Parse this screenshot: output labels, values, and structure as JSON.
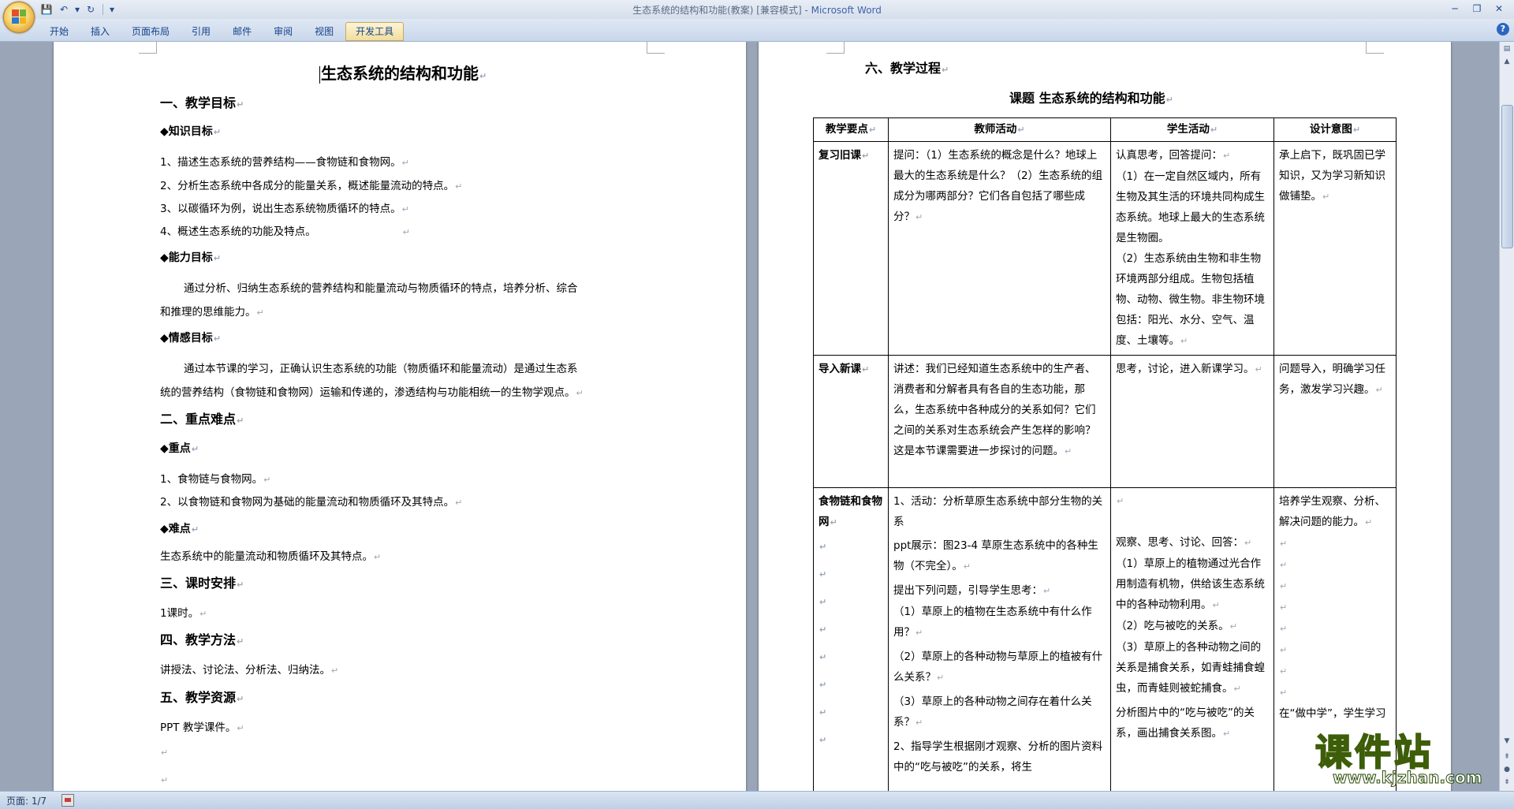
{
  "window": {
    "title_doc": "生态系统的结构和功能(教案) [兼容模式] - ",
    "title_app": "Microsoft Word",
    "controls": [
      "─",
      "❐",
      "✕"
    ]
  },
  "qat": {
    "save": "💾",
    "undo": "↶",
    "undo_dd": "▾",
    "redo": "↻",
    "customize": "▾"
  },
  "ribbon": {
    "tabs": [
      "开始",
      "插入",
      "页面布局",
      "引用",
      "邮件",
      "审阅",
      "视图",
      "开发工具"
    ],
    "active_tab": "开发工具",
    "help": "?"
  },
  "page1": {
    "title": "生态系统的结构和功能",
    "s1": "一、教学目标",
    "knowledge": "◆知识目标",
    "k1": "1、描述生态系统的营养结构——食物链和食物网。",
    "k2": "2、分析生态系统中各成分的能量关系，概述能量流动的特点。",
    "k3": "3、以碳循环为例，说出生态系统物质循环的特点。",
    "k4": "4、概述生态系统的功能及特点。",
    "ability": "◆能力目标",
    "ab1": "通过分析、归纳生态系统的营养结构和能量流动与物质循环的特点，培养分析、综合",
    "ab2": "和推理的思维能力。",
    "emotion": "◆情感目标",
    "em1": "通过本节课的学习，正确认识生态系统的功能（物质循环和能量流动）是通过生态系",
    "em2": "统的营养结构（食物链和食物网）运输和传递的，渗透结构与功能相统一的生物学观点。",
    "s2": "二、重点难点",
    "key": "◆重点",
    "key1": "1、食物链与食物网。",
    "key2": "2、以食物链和食物网为基础的能量流动和物质循环及其特点。",
    "diff": "◆难点",
    "diff1": "生态系统中的能量流动和物质循环及其特点。",
    "s3": "三、课时安排",
    "hours": "1课时。",
    "s4": "四、教学方法",
    "methods": "讲授法、讨论法、分析法、归纳法。",
    "s5": "五、教学资源",
    "res": "PPT 教学课件。"
  },
  "page2": {
    "s6": "六、教学过程",
    "subject": "课题    生态系统的结构和功能",
    "headers": [
      "教学要点",
      "教师活动",
      "学生活动",
      "设计意图"
    ],
    "r1": {
      "point": "复习旧课",
      "teacher": "提问：（1）生态系统的概念是什么？地球上最大的生态系统是什么？（2）生态系统的组成分为哪两部分？它们各自包括了哪些成分？",
      "student_1": "认真思考，回答提问：",
      "student_2": "（1）在一定自然区域内，所有生物及其生活的环境共同构成生态系统。地球上最大的生态系统是生物圈。",
      "student_3": "（2）生态系统由生物和非生物环境两部分组成。生物包括植物、动物、微生物。非生物环境包括：阳光、水分、空气、温度、土壤等。",
      "design": "承上启下，既巩固已学知识，又为学习新知识做铺垫。"
    },
    "r2": {
      "point": "导入新课",
      "teacher": "讲述：我们已经知道生态系统中的生产者、消费者和分解者具有各自的生态功能，那么，生态系统中各种成分的关系如何？它们之间的关系对生态系统会产生怎样的影响？这是本节课需要进一步探讨的问题。",
      "student": "思考，讨论，进入新课学习。",
      "design": "问题导入，明确学习任务，激发学习兴趣。"
    },
    "r3": {
      "point": "食物链和食物网",
      "teacher_1": "1、活动：分析草原生态系统中部分生物的关系",
      "teacher_2": "ppt展示：图23-4   草原生态系统中的各种生物（不完全）。",
      "teacher_3": "提出下列问题，引导学生思考：",
      "teacher_4": "（1）草原上的植物在生态系统中有什么作用？",
      "teacher_5": "（2）草原上的各种动物与草原上的植被有什么关系？",
      "teacher_6": "（3）草原上的各种动物之间存在着什么关系？",
      "teacher_7": "2、指导学生根据刚才观察、分析的图片资料中的“吃与被吃”的关系，将生",
      "student_1": "观察、思考、讨论、回答：",
      "student_2": "（1）草原上的植物通过光合作用制造有机物，供给该生态系统中的各种动物利用。",
      "student_3": "（2）吃与被吃的关系。",
      "student_4": "（3）草原上的各种动物之间的关系是捕食关系，如青蛙捕食蝗虫，而青蛙则被蛇捕食。",
      "student_5": "分析图片中的“吃与被吃”的关系，画出捕食关系图。",
      "design_1": "培养学生观察、分析、解决问题的能力。",
      "design_2": "在“做中学”，学生学习"
    }
  },
  "status": {
    "page": "页面: 1/7"
  },
  "watermark": {
    "brand": "课件站",
    "url": "www.kjzhan.com"
  }
}
